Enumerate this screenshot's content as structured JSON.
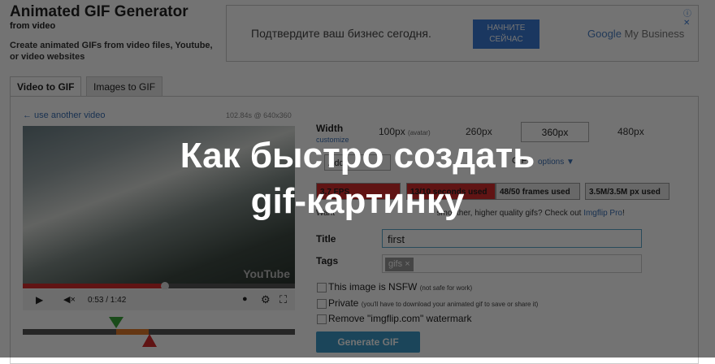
{
  "header": {
    "title": "Animated GIF Generator",
    "subtitle": "from video",
    "description": "Create animated GIFs from video files, Youtube, or video websites"
  },
  "ad": {
    "text": "Подтвердите ваш бизнес сегодня.",
    "button_line1": "НАЧНИТЕ",
    "button_line2": "СЕЙЧАС",
    "brand_google": "Google",
    "brand_rest": " My Business",
    "icons": "ⓘ ✕"
  },
  "tabs": [
    {
      "label": "Video to GIF",
      "active": true
    },
    {
      "label": "Images to GIF",
      "active": false
    }
  ],
  "video": {
    "back_link": "← use another video",
    "info": "102.84s @ 640x360",
    "watermark": "YouTube",
    "time": "0:53 / 1:42",
    "progress": 0.52
  },
  "width": {
    "label": "Width",
    "customize": "customize",
    "options": [
      "100px",
      "260px",
      "360px",
      "480px"
    ],
    "avatar_note": "(avatar)",
    "selected": "360px"
  },
  "row2": {
    "left_text": "Add",
    "mid_text": "GIF",
    "options_link": "options ▼"
  },
  "stats": [
    {
      "label": "3.7 FPS",
      "color": "#d62d2d"
    },
    {
      "label": "13/10 seconds used",
      "color": "#d62d2d"
    },
    {
      "label": "48/50 frames used",
      "color": "#e6e6e6"
    },
    {
      "label": "3.5M/3.5M px used",
      "color": "#e6e6e6"
    }
  ],
  "promo": {
    "text_start": "Want",
    "text_mid": "smoother, higher quality gifs? Check out",
    "link": "Imgflip Pro",
    "end": "!"
  },
  "form": {
    "title_label": "Title",
    "title_value": "first",
    "tags_label": "Tags",
    "tag_value": "gifs",
    "nsfw_label": "This image is NSFW",
    "nsfw_note": "(not safe for work)",
    "private_label": "Private",
    "private_note": "(you'll have to download your animated gif to save or share it)",
    "watermark_label": "Remove \"imgflip.com\" watermark",
    "generate": "Generate GIF"
  },
  "overlay": {
    "line1": "Как быстро создать",
    "line2": "gif-картинку"
  }
}
